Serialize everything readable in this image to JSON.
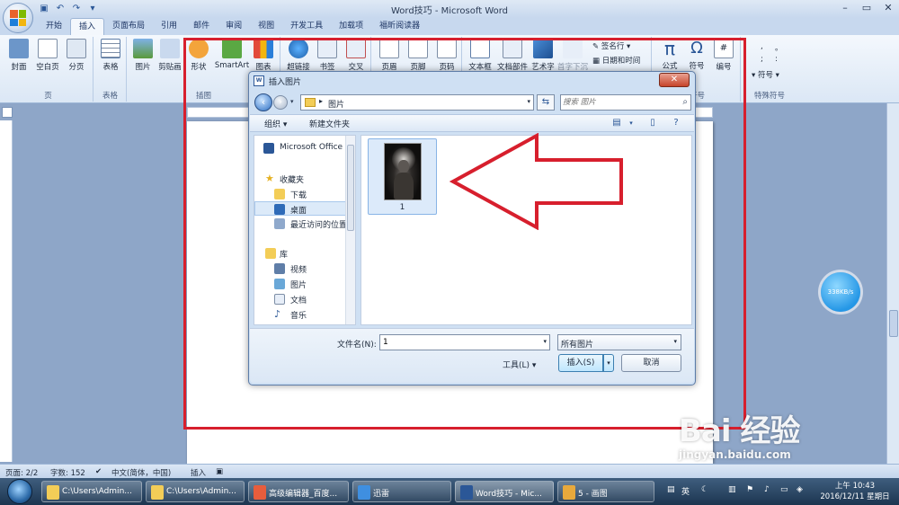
{
  "window": {
    "title": "Word技巧 - Microsoft Word"
  },
  "ribbon_tabs": [
    "开始",
    "插入",
    "页面布局",
    "引用",
    "邮件",
    "审阅",
    "视图",
    "开发工具",
    "加载项",
    "福昕阅读器"
  ],
  "active_tab": "插入",
  "ribbon": {
    "page_group": {
      "label": "页",
      "buttons": [
        "封面",
        "空白页",
        "分页"
      ]
    },
    "table_group": {
      "label": "表格",
      "buttons": [
        "表格"
      ]
    },
    "illustrations_group": {
      "label": "插图",
      "buttons": [
        "图片",
        "剪贴画",
        "形状",
        "SmartArt",
        "图表"
      ]
    },
    "links_buttons": [
      "超链接",
      "书签",
      "交叉"
    ],
    "header_footer_buttons": [
      "页眉",
      "页脚",
      "页码"
    ],
    "text_buttons": [
      "文本框",
      "文档部件",
      "艺术字",
      "首字下沉"
    ],
    "text_small": [
      "签名行",
      "日期和时间"
    ],
    "symbols": {
      "buttons": [
        "公式",
        "符号",
        "编号"
      ],
      "label": "符号"
    },
    "special_symbols": {
      "label": "特殊符号",
      "items": [
        ",",
        "。",
        ";",
        ":",
        "符号"
      ]
    }
  },
  "dialog": {
    "title": "插入图片",
    "close_symbol": "✕",
    "address_path": "图片",
    "search_placeholder": "搜索 图片",
    "toolbar": {
      "organize": "组织 ▾",
      "new_folder": "新建文件夹"
    },
    "nav": {
      "top_item": "Microsoft Office",
      "favorites_header": "收藏夹",
      "favorites": [
        "下载",
        "桌面",
        "最近访问的位置"
      ],
      "selected": "桌面",
      "library_header": "库",
      "libraries": [
        "视频",
        "图片",
        "文档",
        "音乐"
      ]
    },
    "files": [
      {
        "name": "1"
      }
    ],
    "filename_label": "文件名(N):",
    "filename_value": "1",
    "filetype_value": "所有图片",
    "tools_label": "工具(L)",
    "insert_button": "插入(S)",
    "cancel_button": "取消"
  },
  "speed_badge": "338KB/s",
  "status_bar": {
    "page": "页面: 2/2",
    "words": "字数: 152",
    "language": "中文(简体，中国)",
    "mode": "插入"
  },
  "taskbar": {
    "items": [
      {
        "label": "C:\\Users\\Admin...",
        "icon_color": "#f3cd57"
      },
      {
        "label": "C:\\Users\\Admin...",
        "icon_color": "#f3cd57"
      },
      {
        "label": "高级编辑器_百度...",
        "icon_color": "#e85d3c"
      },
      {
        "label": "迅雷",
        "icon_color": "#3f8fe0"
      },
      {
        "label": "Word技巧 - Mic...",
        "icon_color": "#2b5797"
      },
      {
        "label": "5 - 画图",
        "icon_color": "#e8a93c"
      }
    ],
    "tray_text": "英",
    "clock_time": "上午 10:43",
    "clock_date": "2016/12/11 星期日"
  },
  "watermark": {
    "logo": "Bai 经验",
    "url": "jingyan.baidu.com"
  }
}
